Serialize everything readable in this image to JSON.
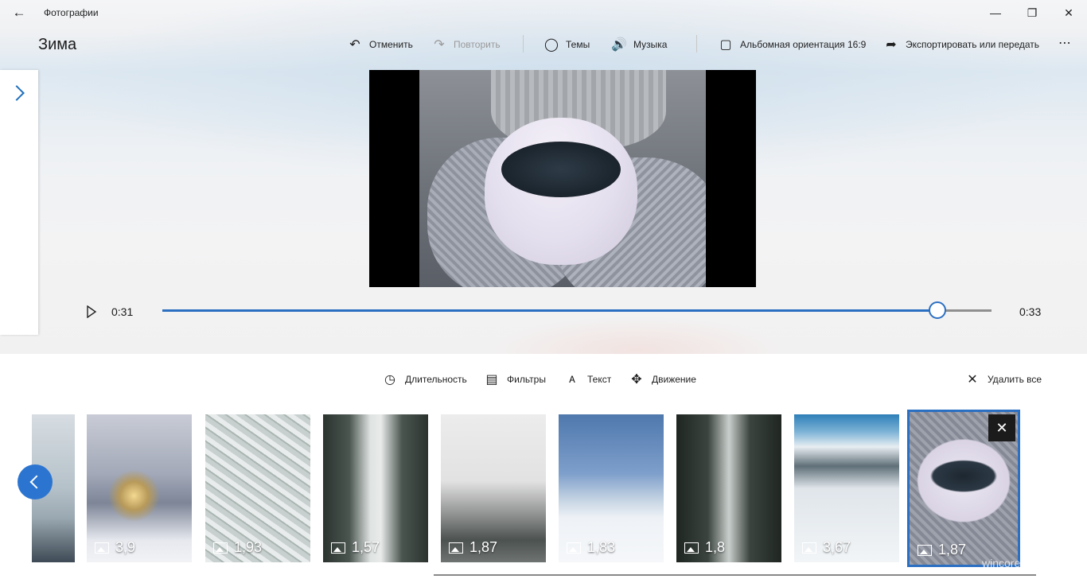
{
  "window": {
    "app_title": "Фотографии"
  },
  "project": {
    "title": "Зима"
  },
  "toolbar": {
    "undo": "Отменить",
    "redo": "Повторить",
    "themes": "Темы",
    "music": "Музыка",
    "orientation": "Альбомная ориентация 16:9",
    "export": "Экспортировать или передать"
  },
  "playback": {
    "current_time": "0:31",
    "end_time": "0:33",
    "progress": 0.935
  },
  "tools": {
    "duration": "Длительность",
    "filters": "Фильтры",
    "text": "Текст",
    "motion": "Движение",
    "delete_all": "Удалить все"
  },
  "storyboard": {
    "clips": [
      {
        "duration": "3,9",
        "scene": "lantern"
      },
      {
        "duration": "1,93",
        "scene": "frost-branch"
      },
      {
        "duration": "1,57",
        "scene": "forest-road"
      },
      {
        "duration": "1,87",
        "scene": "fog-forest"
      },
      {
        "duration": "1,83",
        "scene": "snow-field"
      },
      {
        "duration": "1,8",
        "scene": "misty-road"
      },
      {
        "duration": "3,67",
        "scene": "mountains"
      },
      {
        "duration": "1,87",
        "scene": "coffee-cup",
        "selected": true
      }
    ]
  },
  "watermark": "wincore.ru",
  "colors": {
    "accent": "#2b6fc2"
  }
}
